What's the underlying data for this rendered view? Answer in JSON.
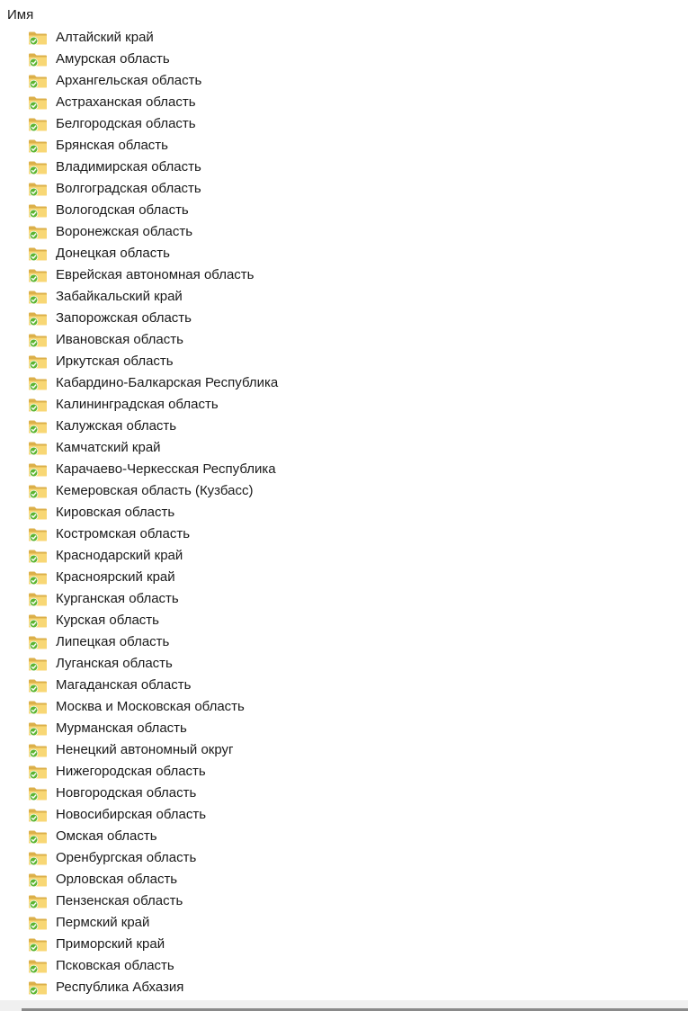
{
  "header": {
    "name_column": "Имя"
  },
  "icon": "folder-synced-icon",
  "colors": {
    "folder_back": "#dcb04a",
    "folder_front": "#f8d775",
    "sync_badge": "#5cb531"
  },
  "items": [
    {
      "name": "Алтайский край"
    },
    {
      "name": "Амурская область"
    },
    {
      "name": "Архангельская область"
    },
    {
      "name": "Астраханская область"
    },
    {
      "name": "Белгородская область"
    },
    {
      "name": "Брянская область"
    },
    {
      "name": "Владимирская область"
    },
    {
      "name": "Волгоградская область"
    },
    {
      "name": "Вологодская область"
    },
    {
      "name": "Воронежская область"
    },
    {
      "name": "Донецкая область"
    },
    {
      "name": "Еврейская автономная область"
    },
    {
      "name": "Забайкальский край"
    },
    {
      "name": "Запорожская область"
    },
    {
      "name": "Ивановская область"
    },
    {
      "name": "Иркутская область"
    },
    {
      "name": "Кабардино-Балкарская Республика"
    },
    {
      "name": "Калининградская область"
    },
    {
      "name": "Калужская область"
    },
    {
      "name": "Камчатский край"
    },
    {
      "name": "Карачаево-Черкесская Республика"
    },
    {
      "name": "Кемеровская область (Кузбасс)"
    },
    {
      "name": "Кировская область"
    },
    {
      "name": "Костромская область"
    },
    {
      "name": "Краснодарский край"
    },
    {
      "name": "Красноярский край"
    },
    {
      "name": "Курганская область"
    },
    {
      "name": "Курская область"
    },
    {
      "name": "Липецкая область"
    },
    {
      "name": "Луганская область"
    },
    {
      "name": "Магаданская область"
    },
    {
      "name": "Москва и Московская область"
    },
    {
      "name": "Мурманская область"
    },
    {
      "name": "Ненецкий автономный округ"
    },
    {
      "name": "Нижегородская область"
    },
    {
      "name": "Новгородская область"
    },
    {
      "name": "Новосибирская область"
    },
    {
      "name": "Омская область"
    },
    {
      "name": "Оренбургская область"
    },
    {
      "name": "Орловская область"
    },
    {
      "name": "Пензенская область"
    },
    {
      "name": "Пермский край"
    },
    {
      "name": "Приморский край"
    },
    {
      "name": "Псковская область"
    },
    {
      "name": "Республика Абхазия"
    }
  ]
}
